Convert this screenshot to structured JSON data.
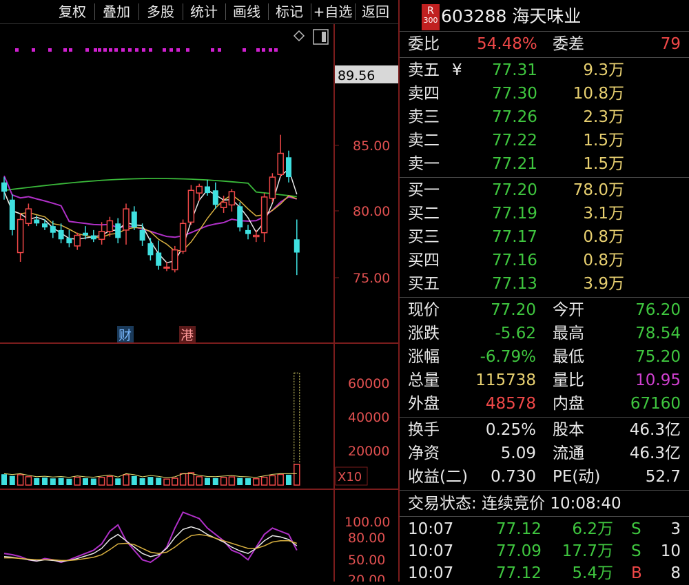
{
  "toolbar": {
    "items": [
      "复权",
      "叠加",
      "多股",
      "统计",
      "画线",
      "标记",
      "+自选",
      "返回"
    ]
  },
  "chart": {
    "price_label_current": "89.56",
    "price_ticks": [
      "85.00",
      "80.00",
      "75.00"
    ],
    "event_markers": [
      "财",
      "港"
    ],
    "volume_ticks": [
      "60000",
      "40000",
      "20000"
    ],
    "volume_unit": "X10",
    "indicator_ticks": [
      "100.00",
      "80.00",
      "50.00",
      "20.00"
    ]
  },
  "chart_data": {
    "type": "candlestick",
    "y_range": [
      73.0,
      91.0
    ],
    "ohlc": [
      [
        82.2,
        82.6,
        80.9,
        81.5
      ],
      [
        80.9,
        81.3,
        78.2,
        78.6
      ],
      [
        76.9,
        79.9,
        76.2,
        79.4
      ],
      [
        79.1,
        80.6,
        78.9,
        80.2
      ],
      [
        79.4,
        79.7,
        78.9,
        79.1
      ],
      [
        79.1,
        79.4,
        78.6,
        78.8
      ],
      [
        78.9,
        79.3,
        78.0,
        78.4
      ],
      [
        78.6,
        79.1,
        77.6,
        77.9
      ],
      [
        78.0,
        78.6,
        77.3,
        77.6
      ],
      [
        77.4,
        78.4,
        77.1,
        78.2
      ],
      [
        78.4,
        78.9,
        77.9,
        78.2
      ],
      [
        78.2,
        78.6,
        77.7,
        77.9
      ],
      [
        77.9,
        79.2,
        77.5,
        78.5
      ],
      [
        78.5,
        79.6,
        78.1,
        79.3
      ],
      [
        79.1,
        79.5,
        77.6,
        78.0
      ],
      [
        78.6,
        80.6,
        77.5,
        80.2
      ],
      [
        80.0,
        80.4,
        78.6,
        78.8
      ],
      [
        78.6,
        79.1,
        77.4,
        77.8
      ],
      [
        77.6,
        78.0,
        76.3,
        76.7
      ],
      [
        76.9,
        77.8,
        75.6,
        75.9
      ],
      [
        75.8,
        76.2,
        75.5,
        75.8
      ],
      [
        75.6,
        77.4,
        75.4,
        77.1
      ],
      [
        77.0,
        79.4,
        76.8,
        79.1
      ],
      [
        79.2,
        82.0,
        79.0,
        81.6
      ],
      [
        81.4,
        82.1,
        80.8,
        81.9
      ],
      [
        81.9,
        82.4,
        81.2,
        81.4
      ],
      [
        81.6,
        82.2,
        80.2,
        80.5
      ],
      [
        80.3,
        81.2,
        79.9,
        80.7
      ],
      [
        80.5,
        81.7,
        80.0,
        81.5
      ],
      [
        80.4,
        80.7,
        78.5,
        78.8
      ],
      [
        78.6,
        79.0,
        77.9,
        78.3
      ],
      [
        78.1,
        78.6,
        77.7,
        78.2
      ],
      [
        78.4,
        81.4,
        77.7,
        81.1
      ],
      [
        81.0,
        82.9,
        80.7,
        82.6
      ],
      [
        82.8,
        85.8,
        82.6,
        84.4
      ],
      [
        84.1,
        84.6,
        82.2,
        82.6
      ],
      [
        77.9,
        79.4,
        75.2,
        76.9
      ]
    ],
    "volume_range": [
      0,
      70000
    ],
    "volume": [
      6500,
      5500,
      6200,
      5000,
      4200,
      4500,
      4000,
      4300,
      3800,
      4700,
      4100,
      3900,
      4600,
      5200,
      4000,
      6200,
      5400,
      4100,
      4900,
      4400,
      3600,
      4100,
      6800,
      7400,
      5000,
      4300,
      4200,
      4600,
      4900,
      4300,
      4100,
      3800,
      4700,
      5600,
      6400,
      6200,
      67000
    ],
    "indicator_range": [
      0,
      110
    ]
  },
  "stock": {
    "badge_top": "R",
    "badge_bottom": "300",
    "code_name": "603288 海天味业"
  },
  "weibi": {
    "label": "委比",
    "value": "54.48%",
    "diff_label": "委差",
    "diff_value": "79"
  },
  "sell": [
    {
      "label": "卖五",
      "mark": "¥",
      "price": "77.31",
      "vol": "9.3万"
    },
    {
      "label": "卖四",
      "mark": "",
      "price": "77.30",
      "vol": "10.8万"
    },
    {
      "label": "卖三",
      "mark": "",
      "price": "77.26",
      "vol": "2.3万"
    },
    {
      "label": "卖二",
      "mark": "",
      "price": "77.22",
      "vol": "1.5万"
    },
    {
      "label": "卖一",
      "mark": "",
      "price": "77.21",
      "vol": "1.5万"
    }
  ],
  "buy": [
    {
      "label": "买一",
      "price": "77.20",
      "vol": "78.0万"
    },
    {
      "label": "买二",
      "price": "77.19",
      "vol": "3.1万"
    },
    {
      "label": "买三",
      "price": "77.17",
      "vol": "0.8万"
    },
    {
      "label": "买四",
      "price": "77.16",
      "vol": "0.8万"
    },
    {
      "label": "买五",
      "price": "77.13",
      "vol": "3.9万"
    }
  ],
  "stats1": [
    {
      "l1": "现价",
      "v1": "77.20",
      "c1": "green",
      "l2": "今开",
      "v2": "76.20",
      "c2": "green"
    },
    {
      "l1": "涨跌",
      "v1": "-5.62",
      "c1": "green",
      "l2": "最高",
      "v2": "78.54",
      "c2": "green"
    },
    {
      "l1": "涨幅",
      "v1": "-6.79%",
      "c1": "green",
      "l2": "最低",
      "v2": "75.20",
      "c2": "green"
    },
    {
      "l1": "总量",
      "v1": "115738",
      "c1": "yellow",
      "l2": "量比",
      "v2": "10.95",
      "c2": "magenta"
    },
    {
      "l1": "外盘",
      "v1": "48578",
      "c1": "red",
      "l2": "内盘",
      "v2": "67160",
      "c2": "green"
    }
  ],
  "stats2": [
    {
      "l1": "换手",
      "v1": "0.25%",
      "l2": "股本",
      "v2": "46.3亿"
    },
    {
      "l1": "净资",
      "v1": "5.09",
      "l2": "流通",
      "v2": "46.3亿"
    },
    {
      "l1": "收益(二)",
      "v1": "0.730",
      "l2": "PE(动)",
      "v2": "52.7"
    }
  ],
  "trade_status": "交易状态: 连续竞价 10:08:40",
  "ticks": [
    {
      "time": "10:07",
      "price": "77.12",
      "vol": "6.2万",
      "side": "S",
      "num": "3"
    },
    {
      "time": "10:07",
      "price": "77.09",
      "vol": "17.7万",
      "side": "S",
      "num": "10"
    },
    {
      "time": "10:07",
      "price": "77.12",
      "vol": "5.4万",
      "side": "B",
      "num": "8"
    }
  ],
  "colors": {
    "up": "#f04848",
    "down": "#3fe0e0",
    "volume_bar": "#5b5bff",
    "border": "#7a1c1c"
  }
}
